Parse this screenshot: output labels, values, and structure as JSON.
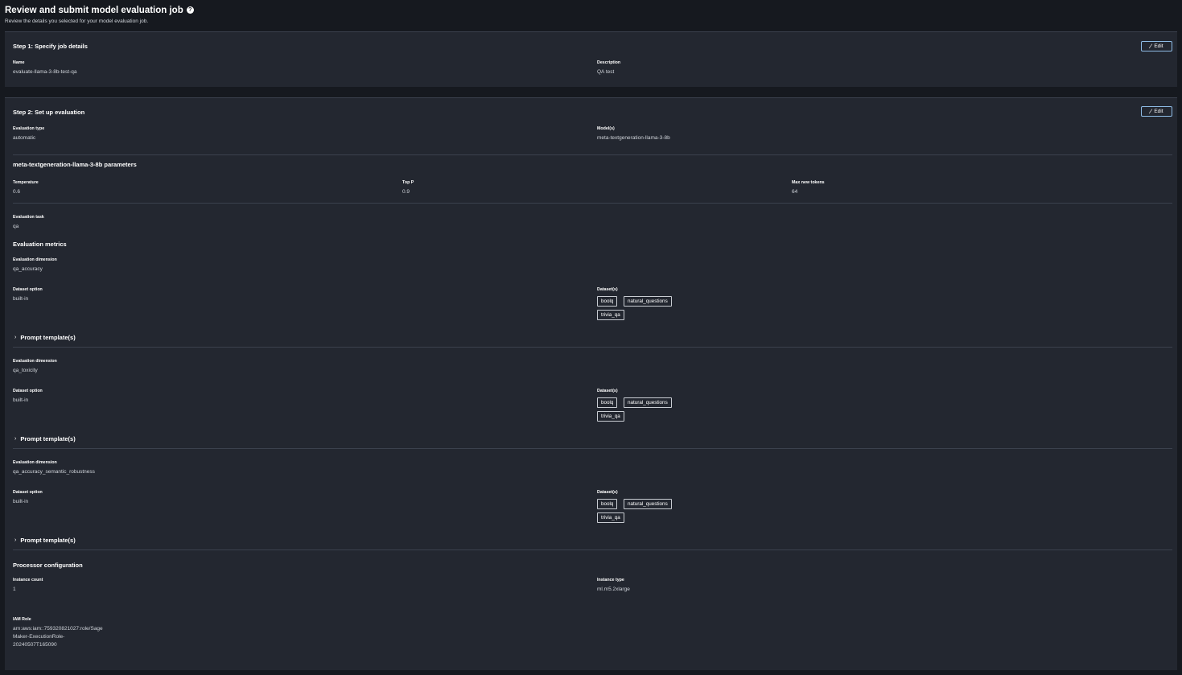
{
  "header": {
    "title": "Review and submit model evaluation job",
    "subtitle": "Review the details you selected for your model evaluation job."
  },
  "step1": {
    "title": "Step 1: Specify job details",
    "edit_label": "Edit",
    "name_label": "Name",
    "name_value": "evaluate-llama-3-8b-test-qa",
    "description_label": "Description",
    "description_value": "QA test"
  },
  "step2": {
    "title": "Step 2: Set up evaluation",
    "edit_label": "Edit",
    "evaluation_type_label": "Evaluation type",
    "evaluation_type_value": "automatic",
    "models_label": "Model(s)",
    "models_value": "meta-textgeneration-llama-3-8b",
    "params_title": "meta-textgeneration-llama-3-8b parameters",
    "temperature_label": "Temperature",
    "temperature_value": "0.6",
    "top_p_label": "Top P",
    "top_p_value": "0.9",
    "max_tokens_label": "Max new tokens",
    "max_tokens_value": "64",
    "task_label": "Evaluation task",
    "task_value": "qa",
    "metrics_title": "Evaluation metrics",
    "dimensions": [
      {
        "dimension_label": "Evaluation dimension",
        "dimension_value": "qa_accuracy",
        "dataset_option_label": "Dataset option",
        "dataset_option_value": "built-in",
        "datasets_label": "Dataset(s)",
        "datasets": [
          "boolq",
          "natural_questions",
          "trivia_qa"
        ],
        "prompt_label": "Prompt template(s)"
      },
      {
        "dimension_label": "Evaluation dimension",
        "dimension_value": "qa_toxicity",
        "dataset_option_label": "Dataset option",
        "dataset_option_value": "built-in",
        "datasets_label": "Dataset(s)",
        "datasets": [
          "boolq",
          "natural_questions",
          "trivia_qa"
        ],
        "prompt_label": "Prompt template(s)"
      },
      {
        "dimension_label": "Evaluation dimension",
        "dimension_value": "qa_accuracy_semantic_robustness",
        "dataset_option_label": "Dataset option",
        "dataset_option_value": "built-in",
        "datasets_label": "Dataset(s)",
        "datasets": [
          "boolq",
          "natural_questions",
          "trivia_qa"
        ],
        "prompt_label": "Prompt template(s)"
      }
    ],
    "processor_title": "Processor configuration",
    "instance_count_label": "Instance count",
    "instance_count_value": "1",
    "instance_type_label": "Instance type",
    "instance_type_value": "ml.m5.2xlarge",
    "iam_role_label": "IAM Role",
    "iam_role_lines": [
      "arn:aws:iam::759320821027:role/Sage",
      "Maker-ExecutionRole-",
      "20240507T165090"
    ]
  },
  "colors": {
    "page_bg": "#16191f",
    "panel_bg": "#232730",
    "button_border": "#8fbce6"
  },
  "icons": {
    "help": "help-circle-icon",
    "edit": "pencil-icon",
    "expand": "chevron-right-icon"
  }
}
